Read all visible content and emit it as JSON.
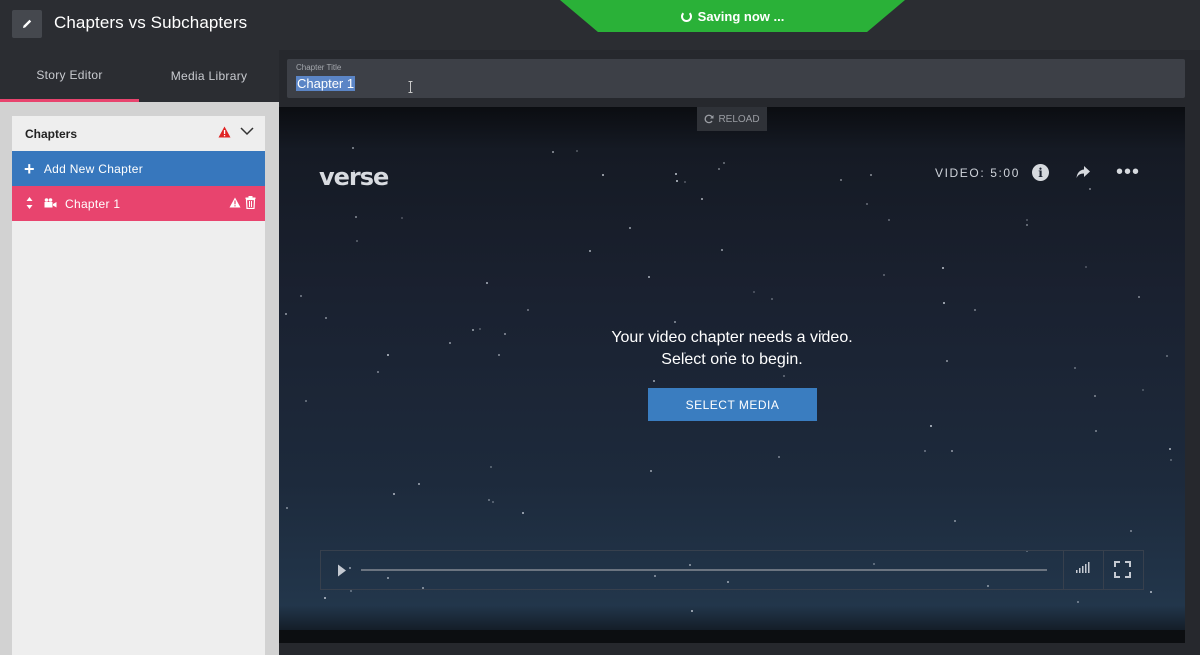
{
  "header": {
    "title": "Chapters vs Subchapters",
    "saving_label": "Saving now ...",
    "edit_icon": "pencil-icon"
  },
  "sidebar": {
    "tabs": [
      {
        "label": "Story Editor",
        "active": true
      },
      {
        "label": "Media Library",
        "active": false
      }
    ],
    "chapters_heading": "Chapters",
    "add_chapter_label": "Add New Chapter",
    "chapters": [
      {
        "label": "Chapter 1",
        "icon": "video-camera-icon"
      }
    ]
  },
  "editor": {
    "chapter_title_label": "Chapter Title",
    "chapter_title_value": "Chapter 1",
    "reload_label": "RELOAD"
  },
  "player": {
    "logo": "verse",
    "video_duration": "VIDEO: 5:00",
    "message_line1": "Your video chapter needs a video.",
    "message_line2": "Select one to begin.",
    "select_button": "SELECT MEDIA"
  },
  "colors": {
    "saving_green": "#2ab138",
    "active_pink": "#e8446e",
    "button_blue": "#3777bd",
    "warning_red": "#e02424"
  }
}
